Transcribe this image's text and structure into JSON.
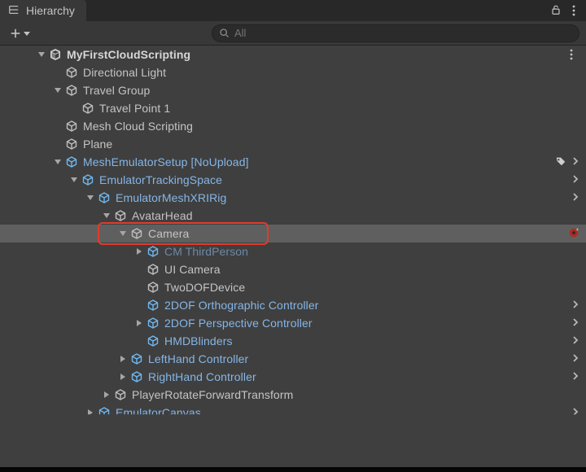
{
  "window": {
    "tab_title": "Hierarchy",
    "search_placeholder": "All"
  },
  "tree": {
    "root": {
      "name": "MyFirstCloudScripting",
      "children": [
        {
          "name": "Directional Light"
        },
        {
          "name": "Travel Group",
          "expanded": true,
          "children": [
            {
              "name": "Travel Point 1"
            }
          ]
        },
        {
          "name": "Mesh Cloud Scripting"
        },
        {
          "name": "Plane"
        },
        {
          "name": "MeshEmulatorSetup [NoUpload]",
          "prefab": true,
          "expanded": true,
          "has_tag": true,
          "has_chevron": true,
          "children": [
            {
              "name": "EmulatorTrackingSpace",
              "prefab": true,
              "expanded": true,
              "has_chevron": true,
              "children": [
                {
                  "name": "EmulatorMeshXRIRig",
                  "prefab": true,
                  "expanded": true,
                  "has_chevron": true,
                  "children": [
                    {
                      "name": "AvatarHead",
                      "expanded": true,
                      "children": [
                        {
                          "name": "Camera",
                          "expanded": true,
                          "highlighted": true,
                          "selected": true,
                          "has_broken": true,
                          "children": [
                            {
                              "name": "CM ThirdPerson",
                              "prefab_dim": true,
                              "expandable": true
                            },
                            {
                              "name": "UI Camera"
                            },
                            {
                              "name": "TwoDOFDevice"
                            },
                            {
                              "name": "2DOF Orthographic Controller",
                              "prefab": true,
                              "has_chevron": true
                            },
                            {
                              "name": "2DOF Perspective Controller",
                              "prefab": true,
                              "expandable": true,
                              "has_chevron": true
                            },
                            {
                              "name": "HMDBlinders",
                              "prefab": true,
                              "has_chevron": true
                            }
                          ]
                        },
                        {
                          "name": "LeftHand Controller",
                          "prefab": true,
                          "expandable": true,
                          "has_chevron": true
                        },
                        {
                          "name": "RightHand Controller",
                          "prefab": true,
                          "expandable": true,
                          "has_chevron": true
                        }
                      ]
                    },
                    {
                      "name": "PlayerRotateForwardTransform",
                      "expandable": true
                    }
                  ]
                },
                {
                  "name": "EmulatorCanvas",
                  "prefab": true,
                  "expandable": true,
                  "has_chevron": true,
                  "cut": true
                }
              ]
            }
          ]
        }
      ]
    }
  }
}
